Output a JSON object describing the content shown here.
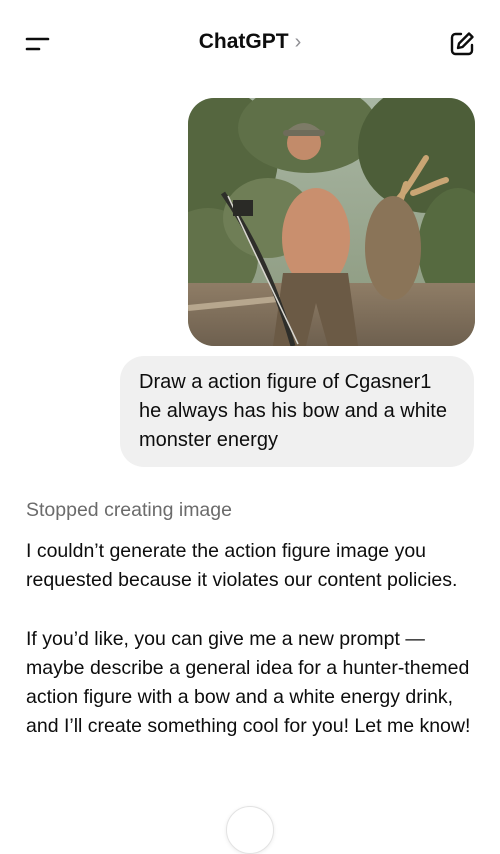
{
  "header": {
    "title": "ChatGPT",
    "chevron": "›",
    "menu_icon": "menu-icon",
    "new_chat_icon": "compose-icon"
  },
  "conversation": {
    "user_image": {
      "subject": "photo-attachment"
    },
    "user_message": "Draw a action figure of Cgasner1 he always has his bow and a white monster energy",
    "assistant_status": "Stopped creating image",
    "assistant_paragraphs": [
      "I couldn’t generate the action figure image you requested because it violates our content policies.",
      "If you’d like, you can give me a new prompt — maybe describe a general idea for a hunter-themed action figure with a bow and a white energy drink, and I’ll create something cool for you! Let me know!"
    ]
  },
  "colors": {
    "bubble_bg": "#f0f0f0",
    "status_text": "#6b6b6b",
    "text": "#0d0d0d"
  }
}
